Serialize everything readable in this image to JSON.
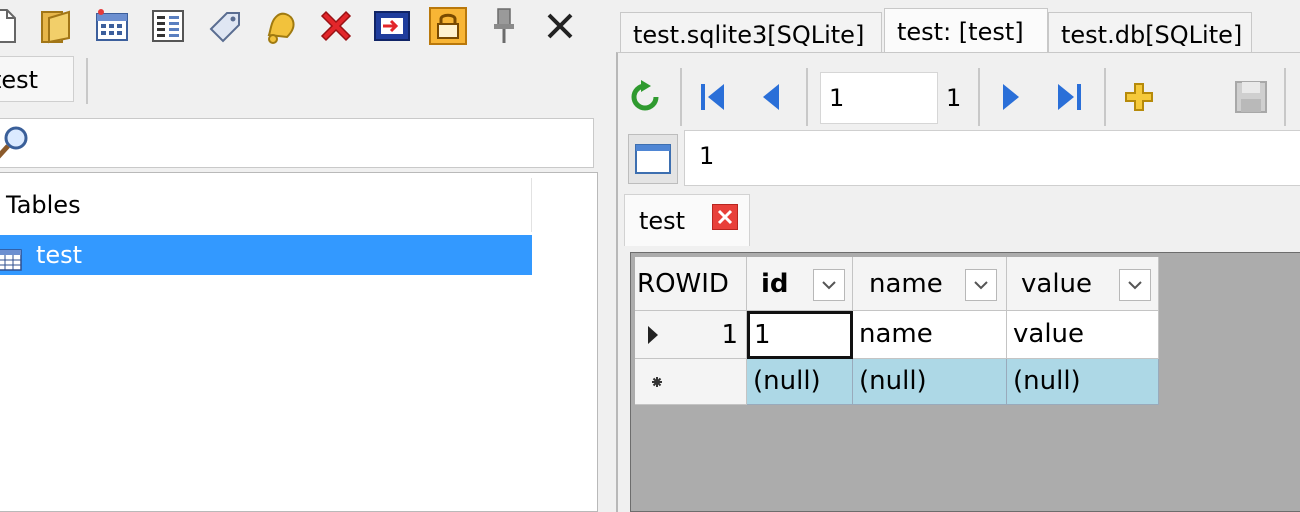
{
  "left_panel": {
    "tab_label": "test",
    "tree_header": "Tables",
    "selected_table": "test"
  },
  "document_tabs": [
    {
      "label": "test.sqlite3[SQLite]",
      "active": false
    },
    {
      "label": "test: [test]",
      "active": true
    },
    {
      "label": "test.db[SQLite]",
      "active": false
    }
  ],
  "navigator": {
    "page_value": "1",
    "page_count": "1"
  },
  "sql_text": "1",
  "result_tab": {
    "label": "test"
  },
  "grid": {
    "columns": [
      {
        "label": "ROWID",
        "bold": false
      },
      {
        "label": "id",
        "bold": true
      },
      {
        "label": "name",
        "bold": false
      },
      {
        "label": "value",
        "bold": false
      }
    ],
    "rows": [
      {
        "rowid": "1",
        "cells": [
          "1",
          "name",
          "value"
        ]
      }
    ],
    "new_row": [
      "(null)",
      "(null)",
      "(null)"
    ]
  },
  "colors": {
    "selection": "#3399ff",
    "new_row_bg": "#add8e6",
    "grid_bg": "#acacac"
  },
  "icons": {
    "toolbar": [
      "new-file-icon",
      "open-folder-icon",
      "calendar-table-icon",
      "list-view-icon",
      "tag-icon",
      "bell-icon",
      "delete-icon",
      "export-icon",
      "lock-icon",
      "pin-icon",
      "close-icon"
    ],
    "navigator": [
      "refresh-icon",
      "first-record-icon",
      "prev-record-icon",
      "next-record-icon",
      "last-record-icon",
      "add-record-icon",
      "save-icon"
    ]
  }
}
